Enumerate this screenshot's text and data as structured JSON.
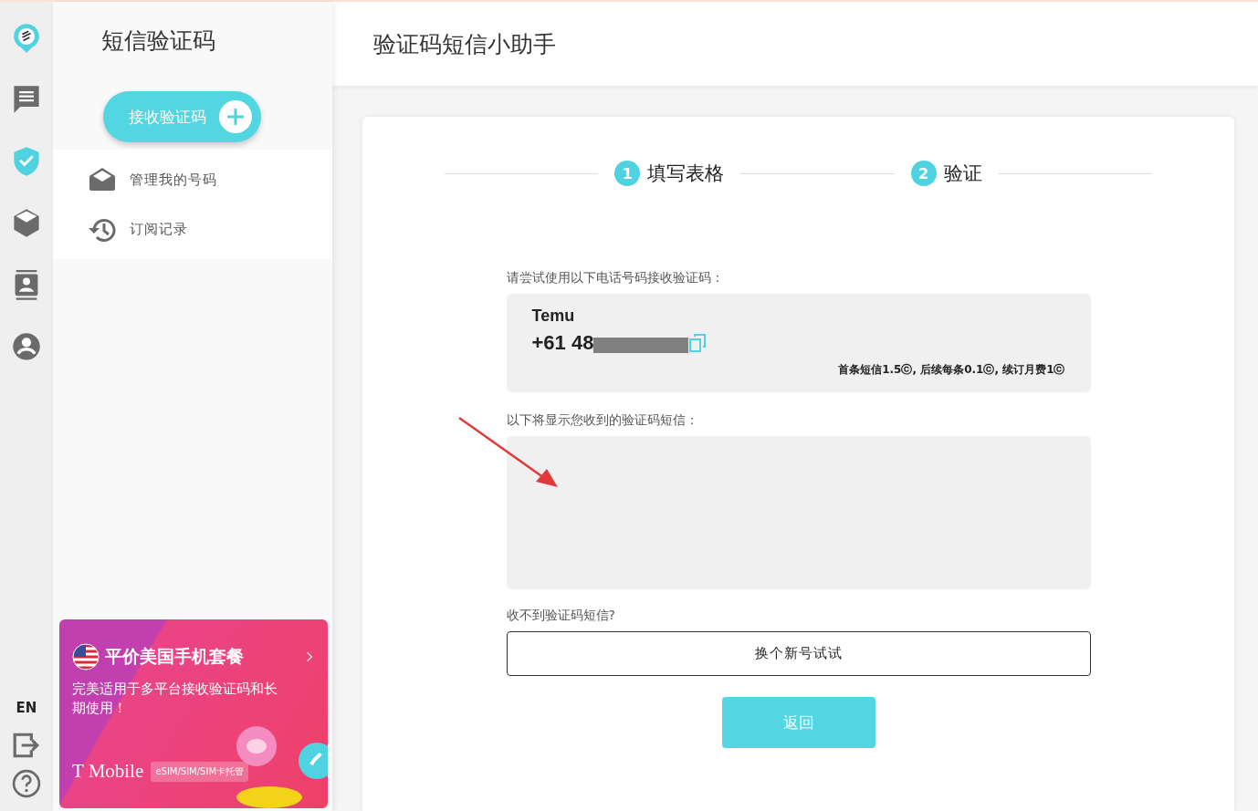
{
  "rail": {
    "items": [
      {
        "kind": "chat",
        "selected": false
      },
      {
        "kind": "shield",
        "selected": true
      },
      {
        "kind": "cube",
        "selected": false
      },
      {
        "kind": "contacts",
        "selected": false
      },
      {
        "kind": "account",
        "selected": false
      }
    ],
    "language": "EN"
  },
  "sidebar": {
    "title": "短信验证码",
    "receive_button": "接收验证码",
    "items": [
      {
        "kind": "mail",
        "label": "管理我的号码"
      },
      {
        "kind": "history",
        "label": "订阅记录"
      }
    ],
    "promo": {
      "title": "平价美国手机套餐",
      "text": "完美适用于多平台接收验证码和长期使用！",
      "brand": "T Mobile",
      "tag": "eSIM/SIM/SIM卡托管"
    }
  },
  "header": {
    "title": "验证码短信小助手"
  },
  "steps": [
    {
      "number": "1",
      "label": "填写表格"
    },
    {
      "number": "2",
      "label": "验证"
    }
  ],
  "form": {
    "phone_prompt": "请尝试使用以下电话号码接收验证码：",
    "service": "Temu",
    "phone_number": "+61 48",
    "pricing": "首条短信1.5ⓒ, 后续每条0.1ⓒ, 续订月费1ⓒ",
    "sms_prompt": "以下将显示您收到的验证码短信：",
    "no_sms_prompt": "收不到验证码短信?",
    "switch_button": "换个新号试试",
    "back_button": "返回"
  }
}
